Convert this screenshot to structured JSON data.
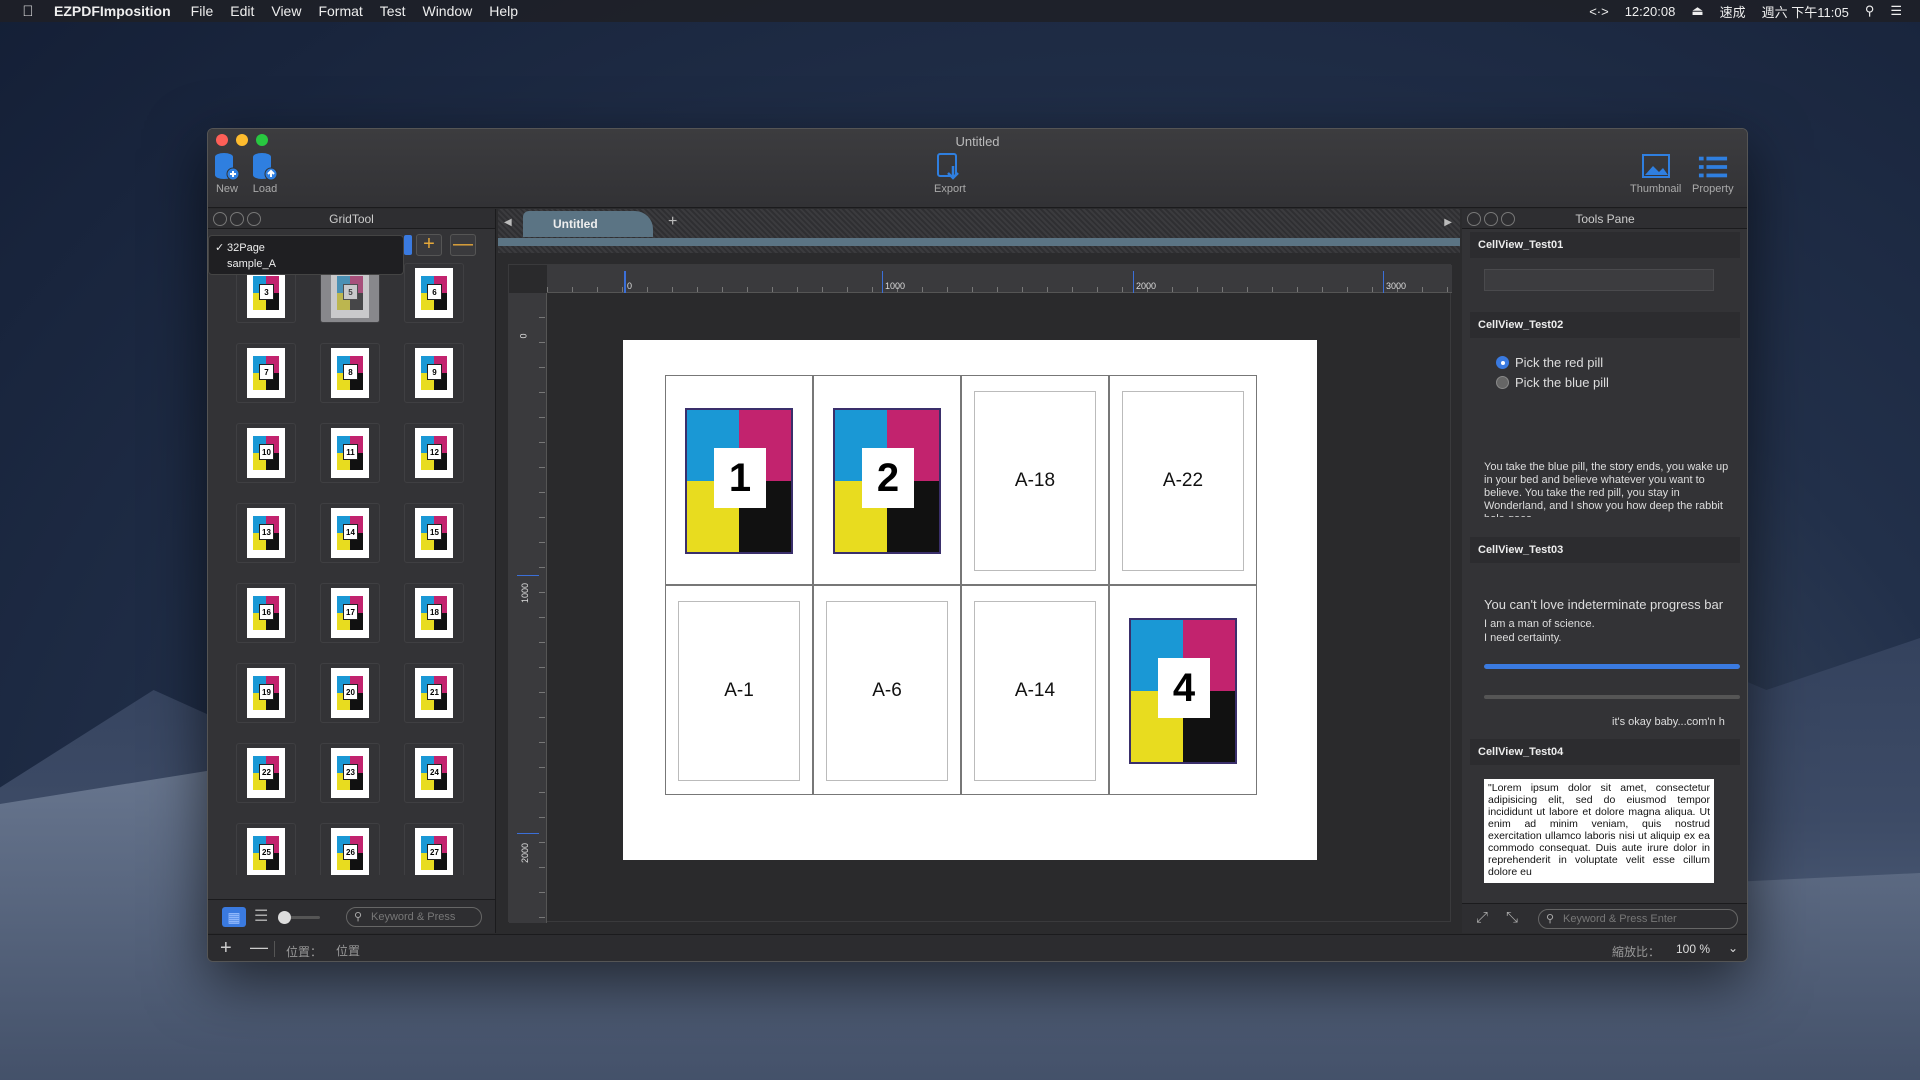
{
  "menubar": {
    "app_name": "EZPDFImposition",
    "items": [
      "File",
      "Edit",
      "View",
      "Format",
      "Test",
      "Window",
      "Help"
    ],
    "status_time_label": "12:20:08",
    "input_method": "速成",
    "datetime": "週六 下午11:05"
  },
  "window": {
    "title": "Untitled"
  },
  "toolbar": {
    "new_label": "New",
    "load_label": "Load",
    "export_label": "Export",
    "thumbnail_label": "Thumbnail",
    "property_label": "Property"
  },
  "gridtool": {
    "title": "GridTool",
    "dropdown_options": [
      "32Page",
      "sample_A"
    ],
    "selected_option": "32Page",
    "search_placeholder": "Keyword & Press",
    "thumbs": [
      "3",
      "5",
      "6",
      "7",
      "8",
      "9",
      "10",
      "11",
      "12",
      "13",
      "14",
      "15",
      "16",
      "17",
      "18",
      "19",
      "20",
      "21",
      "22",
      "23",
      "24",
      "25",
      "26",
      "27"
    ],
    "selected_thumb": "5"
  },
  "tabs": {
    "active": "Untitled"
  },
  "rulers": {
    "h_labels": [
      "0",
      "1000",
      "2000",
      "3000"
    ],
    "v_labels": [
      "0",
      "1000",
      "2000"
    ]
  },
  "sheet": {
    "cells": [
      {
        "type": "art",
        "label": "1"
      },
      {
        "type": "art",
        "label": "2"
      },
      {
        "type": "blank",
        "label": "A-18"
      },
      {
        "type": "blank",
        "label": "A-22"
      },
      {
        "type": "blank",
        "label": "A-1"
      },
      {
        "type": "blank",
        "label": "A-6"
      },
      {
        "type": "blank",
        "label": "A-14"
      },
      {
        "type": "art",
        "label": "4"
      }
    ]
  },
  "tools_pane": {
    "title": "Tools Pane",
    "sections": [
      "CellView_Test01",
      "CellView_Test02",
      "CellView_Test03",
      "CellView_Test04"
    ],
    "radio_red": "Pick the red pill",
    "radio_blue": "Pick the blue pill",
    "pill_text": "You take the blue pill, the story ends, you wake up in your bed and believe whatever you want to believe. You take the red pill, you stay in Wonderland, and I show you how deep the rabbit hole goes.",
    "progress_heading": "You can't love indeterminate progress bar",
    "science_line1": "I am a man of science.",
    "science_line2": "I need certainty.",
    "progress_value": 1.0,
    "okay_text": "it's okay baby...com'n h",
    "lorem": "\"Lorem ipsum dolor sit amet, consectetur adipisicing elit, sed do eiusmod tempor incididunt ut labore et dolore magna aliqua. Ut enim ad minim veniam, quis nostrud exercitation ullamco laboris nisi ut aliquip ex ea commodo consequat. Duis aute irure dolor in reprehenderit in voluptate velit esse cillum dolore eu",
    "search_placeholder": "Keyword & Press Enter"
  },
  "statusbar": {
    "pos_label": "位置：",
    "pos_value": "位置",
    "zoom_label": "縮放比：",
    "zoom_value": "100 %"
  },
  "colors": {
    "cyan": "#1a98d5",
    "magenta": "#c2236e",
    "yellow": "#e8dc1f",
    "black": "#111111",
    "accent": "#3a7ae0"
  }
}
